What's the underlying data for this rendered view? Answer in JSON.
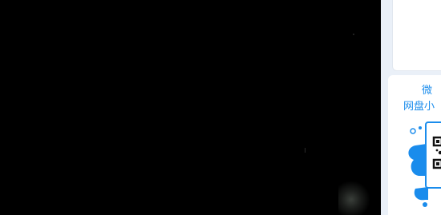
{
  "video": {
    "state": "dark-frame"
  },
  "sidebar": {
    "promo": {
      "title_line1": "微",
      "title_line2": "网盘小",
      "accent_color": "#1a8cec",
      "qr_icon": "qr-code-icon"
    }
  }
}
